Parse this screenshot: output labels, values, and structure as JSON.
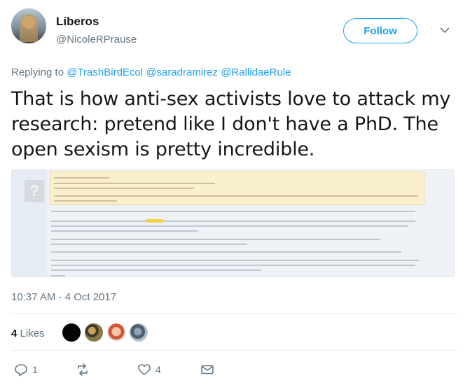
{
  "author": {
    "name": "Liberos",
    "handle": "@NicoleRPrause"
  },
  "follow_label": "Follow",
  "reply": {
    "prefix": "Replying to",
    "mentions": [
      "@TrashBirdEcol",
      "@saradramirez",
      "@RallidaeRule"
    ]
  },
  "tweet_text": "That is how anti-sex activists love to attack my research: pretend like I don't have a PhD. The open sexism is pretty incredible.",
  "timestamp": "10:37 AM - 4 Oct 2017",
  "likes": {
    "count": "4",
    "label": "Likes"
  },
  "actions": {
    "reply_count": "1",
    "retweet_count": "",
    "like_count": "4"
  },
  "colors": {
    "accent": "#1da1f2",
    "secondary_text": "#657786",
    "primary_text": "#14171a"
  }
}
